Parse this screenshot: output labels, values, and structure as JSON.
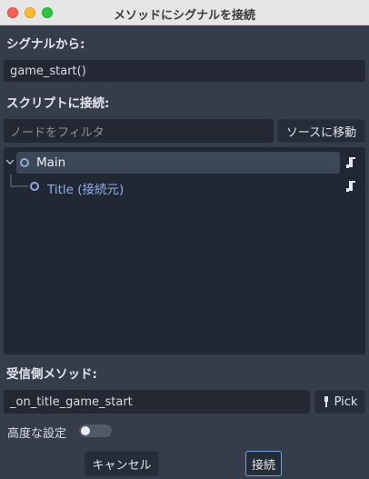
{
  "window": {
    "title": "メソッドにシグナルを接続"
  },
  "signal": {
    "label": "シグナルから:",
    "value": "game_start()"
  },
  "script": {
    "label": "スクリプトに接続:",
    "filter_placeholder": "ノードをフィルタ",
    "goto_source_label": "ソースに移動"
  },
  "tree": {
    "nodes": [
      {
        "name": "Main",
        "selected": true
      },
      {
        "name": "Title (接続元)",
        "selected": false
      }
    ]
  },
  "receiver": {
    "label": "受信側メソッド:",
    "value": "_on_title_game_start",
    "pick_label": "Pick"
  },
  "advanced": {
    "label": "高度な設定",
    "enabled": false
  },
  "footer": {
    "cancel_label": "キャンセル",
    "connect_label": "接続"
  },
  "colors": {
    "background": "#363d4a",
    "accent": "#8fa8e0",
    "title_node": "#8fb1ea"
  }
}
